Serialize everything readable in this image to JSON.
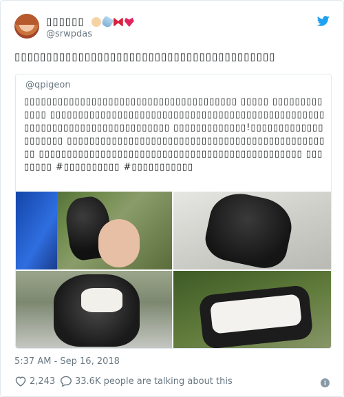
{
  "author": {
    "display_name": "▯▯▯▯▯▯",
    "handle": "@srwpdas",
    "avatar": "profile-photo"
  },
  "tweet": {
    "text": "▯▯▯▯▯▯▯▯▯▯▯▯▯▯▯▯▯▯▯▯▯▯▯▯▯▯▯▯▯▯▯▯▯▯▯▯▯▯▯▯▯",
    "timestamp": "5:37 AM - Sep 16, 2018"
  },
  "quoted": {
    "handle": "@qpigeon",
    "text": "▯▯▯▯▯▯▯▯▯▯▯▯▯▯▯▯▯▯▯▯▯▯▯▯▯▯▯▯▯▯▯▯▯▯▯▯▯▯ ▯▯▯▯▯ ▯▯▯▯▯▯▯▯▯▯▯▯▯ ▯▯▯▯▯▯▯▯▯▯▯▯▯▯▯▯▯▯▯▯▯▯▯▯▯▯▯▯▯▯▯▯▯▯▯▯▯▯▯▯▯▯▯▯▯▯▯▯▯▯▯▯▯▯▯▯▯▯▯▯▯▯▯▯▯▯▯▯▯▯▯▯▯▯▯ ▯▯▯▯▯▯▯▯▯▯▯▯▯!▯▯▯▯▯▯▯▯▯▯▯▯▯▯▯▯▯▯▯▯ ▯▯▯▯▯▯▯▯▯▯▯▯▯▯▯▯▯▯▯▯▯▯▯▯▯▯▯▯▯▯▯▯▯▯▯▯▯▯▯▯▯▯▯▯▯▯▯▯ ▯▯▯▯▯▯▯▯▯▯▯▯▯▯▯▯▯▯▯▯▯▯▯▯▯▯▯▯▯▯▯▯▯▯▯▯▯▯▯▯▯▯▯▯▯▯▯ ▯▯▯▯▯▯▯▯ #▯▯▯▯▯▯▯▯▯▯ #▯▯▯▯▯▯▯▯▯▯▯"
  },
  "photos": [
    "oreo-bar-in-package",
    "dark-bar-held-close-up",
    "bitten-bar-cream-center",
    "bar-cross-section"
  ],
  "actions": {
    "likes": "2,243",
    "talking": "33.6K people are talking about this"
  },
  "colors": {
    "twitter_blue": "#1da1f2",
    "secondary_text": "#697882",
    "border": "#e1e8ed"
  },
  "icons": [
    "twitter-bird-icon",
    "heart-icon",
    "speech-bubble-icon",
    "info-icon"
  ]
}
